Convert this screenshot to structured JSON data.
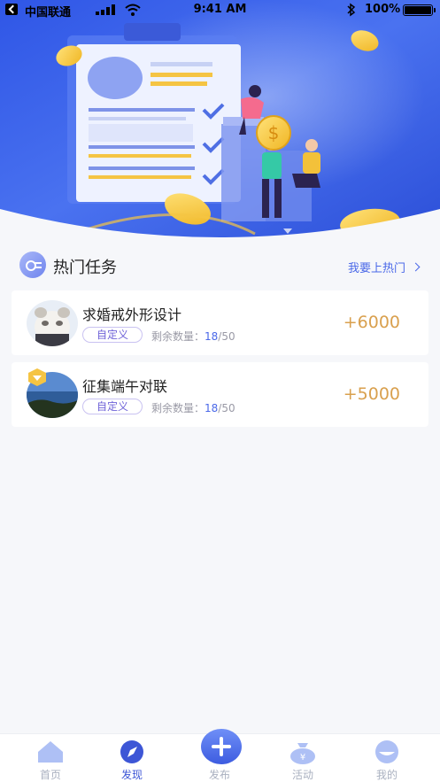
{
  "status_bar": {
    "carrier": "中国联通",
    "time": "9:41 AM",
    "battery": "100%"
  },
  "section": {
    "title": "热门任务",
    "more_link": "我要上热门"
  },
  "tasks": [
    {
      "title": "求婚戒外形设计",
      "tag": "自定义",
      "remain_label": "剩余数量：",
      "remain_current": "18",
      "remain_total": "/50",
      "reward": "+6000"
    },
    {
      "title": "征集端午对联",
      "tag": "自定义",
      "remain_label": "剩余数量：",
      "remain_current": "18",
      "remain_total": "/50",
      "reward": "+5000"
    }
  ],
  "tab_bar": {
    "active_tab": "发现",
    "tabs": [
      {
        "label": "首页",
        "icon": "home-icon"
      },
      {
        "label": "发现",
        "icon": "compass-icon"
      },
      {
        "label": "发布",
        "icon": "plus-icon"
      },
      {
        "label": "活动",
        "icon": "money-bag-icon"
      },
      {
        "label": "我的",
        "icon": "profile-icon"
      }
    ]
  },
  "colors": {
    "brand_blue": "#3d5ce0",
    "reward_gold": "#d9a04e",
    "tag_purple": "#6f63d8",
    "inactive_gray": "#aab1c0"
  }
}
